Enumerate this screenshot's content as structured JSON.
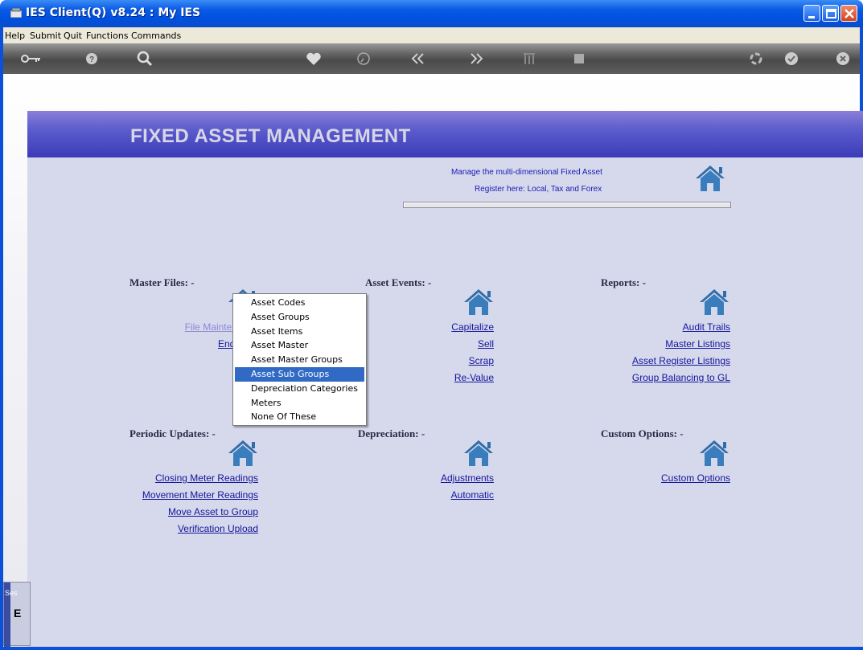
{
  "window": {
    "title": "IES Client(Q) v8.24 : My IES",
    "controls": [
      "minimize-icon",
      "maximize-icon",
      "close-icon"
    ]
  },
  "menubar": [
    "Help",
    "Submit",
    "Quit",
    "Functions",
    "Commands"
  ],
  "toolbar": {
    "icons": [
      "key-icon",
      "help-icon",
      "search-icon",
      "heart-icon",
      "clock-icon",
      "back-icon",
      "forward-icon",
      "tree-icon",
      "stop-icon",
      "recycle-icon",
      "check-icon",
      "close-icon"
    ]
  },
  "app": {
    "title": "FIXED ASSET MANAGEMENT",
    "description_line1": "Manage the multi-dimensional Fixed Asset",
    "description_line2": "Register here: Local, Tax and Forex"
  },
  "sections": {
    "master_files": {
      "title": "Master Files: -",
      "links": [
        "File Maintenance",
        "Enquiries"
      ]
    },
    "asset_events": {
      "title": "Asset Events: -",
      "links": [
        "Capitalize",
        "Sell",
        "Scrap",
        "Re-Value"
      ]
    },
    "reports": {
      "title": "Reports: -",
      "links": [
        "Audit Trails",
        "Master Listings",
        "Asset Register Listings",
        "Group Balancing to GL"
      ]
    },
    "periodic_updates": {
      "title": "Periodic Updates: -",
      "links": [
        "Closing Meter Readings",
        "Movement Meter Readings",
        "Move Asset to Group",
        "Verification Upload"
      ]
    },
    "depreciation": {
      "title": "Depreciation: -",
      "links": [
        "Adjustments",
        "Automatic"
      ]
    },
    "custom_options": {
      "title": "Custom Options: -",
      "links": [
        "Custom Options"
      ]
    }
  },
  "popup_menu": {
    "items": [
      "Asset Codes",
      "Asset Groups",
      "Asset Items",
      "Asset Master",
      "Asset Master Groups",
      "Asset Sub Groups",
      "Depreciation Categories",
      "Meters",
      "None Of These"
    ],
    "selected": "Asset Sub Groups"
  },
  "side_tab": {
    "label": "Ses",
    "glyph": "E"
  },
  "colors": {
    "link": "#14149a",
    "visited_link": "#8a8ad8",
    "banner": "#3b3bb8",
    "panel": "#d6d9ec",
    "menu_highlight": "#316ac5"
  }
}
